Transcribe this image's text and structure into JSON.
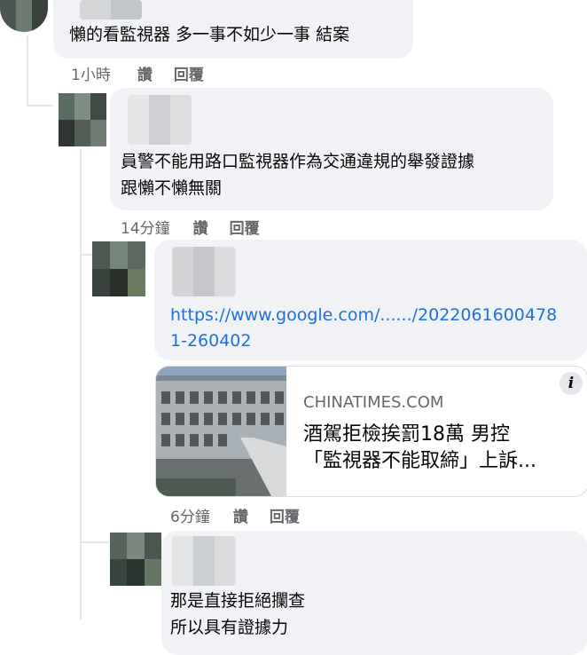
{
  "comments": [
    {
      "text_lines": [
        "懶的看監視器 多一事不如少一事 結案"
      ],
      "meta": {
        "time": "1小時",
        "like": "讚",
        "reply": "回覆"
      }
    },
    {
      "text_lines": [
        "員警不能用路口監視器作為交通違規的舉發證據",
        "跟懶不懶無關"
      ],
      "meta": {
        "time": "14分鐘",
        "like": "讚",
        "reply": "回覆"
      }
    },
    {
      "link_lines": [
        "https://www.google.com/....../2022061600478",
        "1-260402"
      ],
      "preview": {
        "domain": "CHINATIMES.COM",
        "title_lines": [
          "酒駕拒檢挨罰18萬 男控",
          "「監視器不能取締」上訴..."
        ],
        "info_icon": "info-icon"
      },
      "meta": {
        "time": "6分鐘",
        "like": "讚",
        "reply": "回覆"
      }
    },
    {
      "text_lines": [
        "那是直接拒絕攔查",
        "所以具有證據力"
      ]
    }
  ],
  "colors": {
    "bubble": "#f0f2f5",
    "link": "#216fdb",
    "meta": "#65676b"
  }
}
